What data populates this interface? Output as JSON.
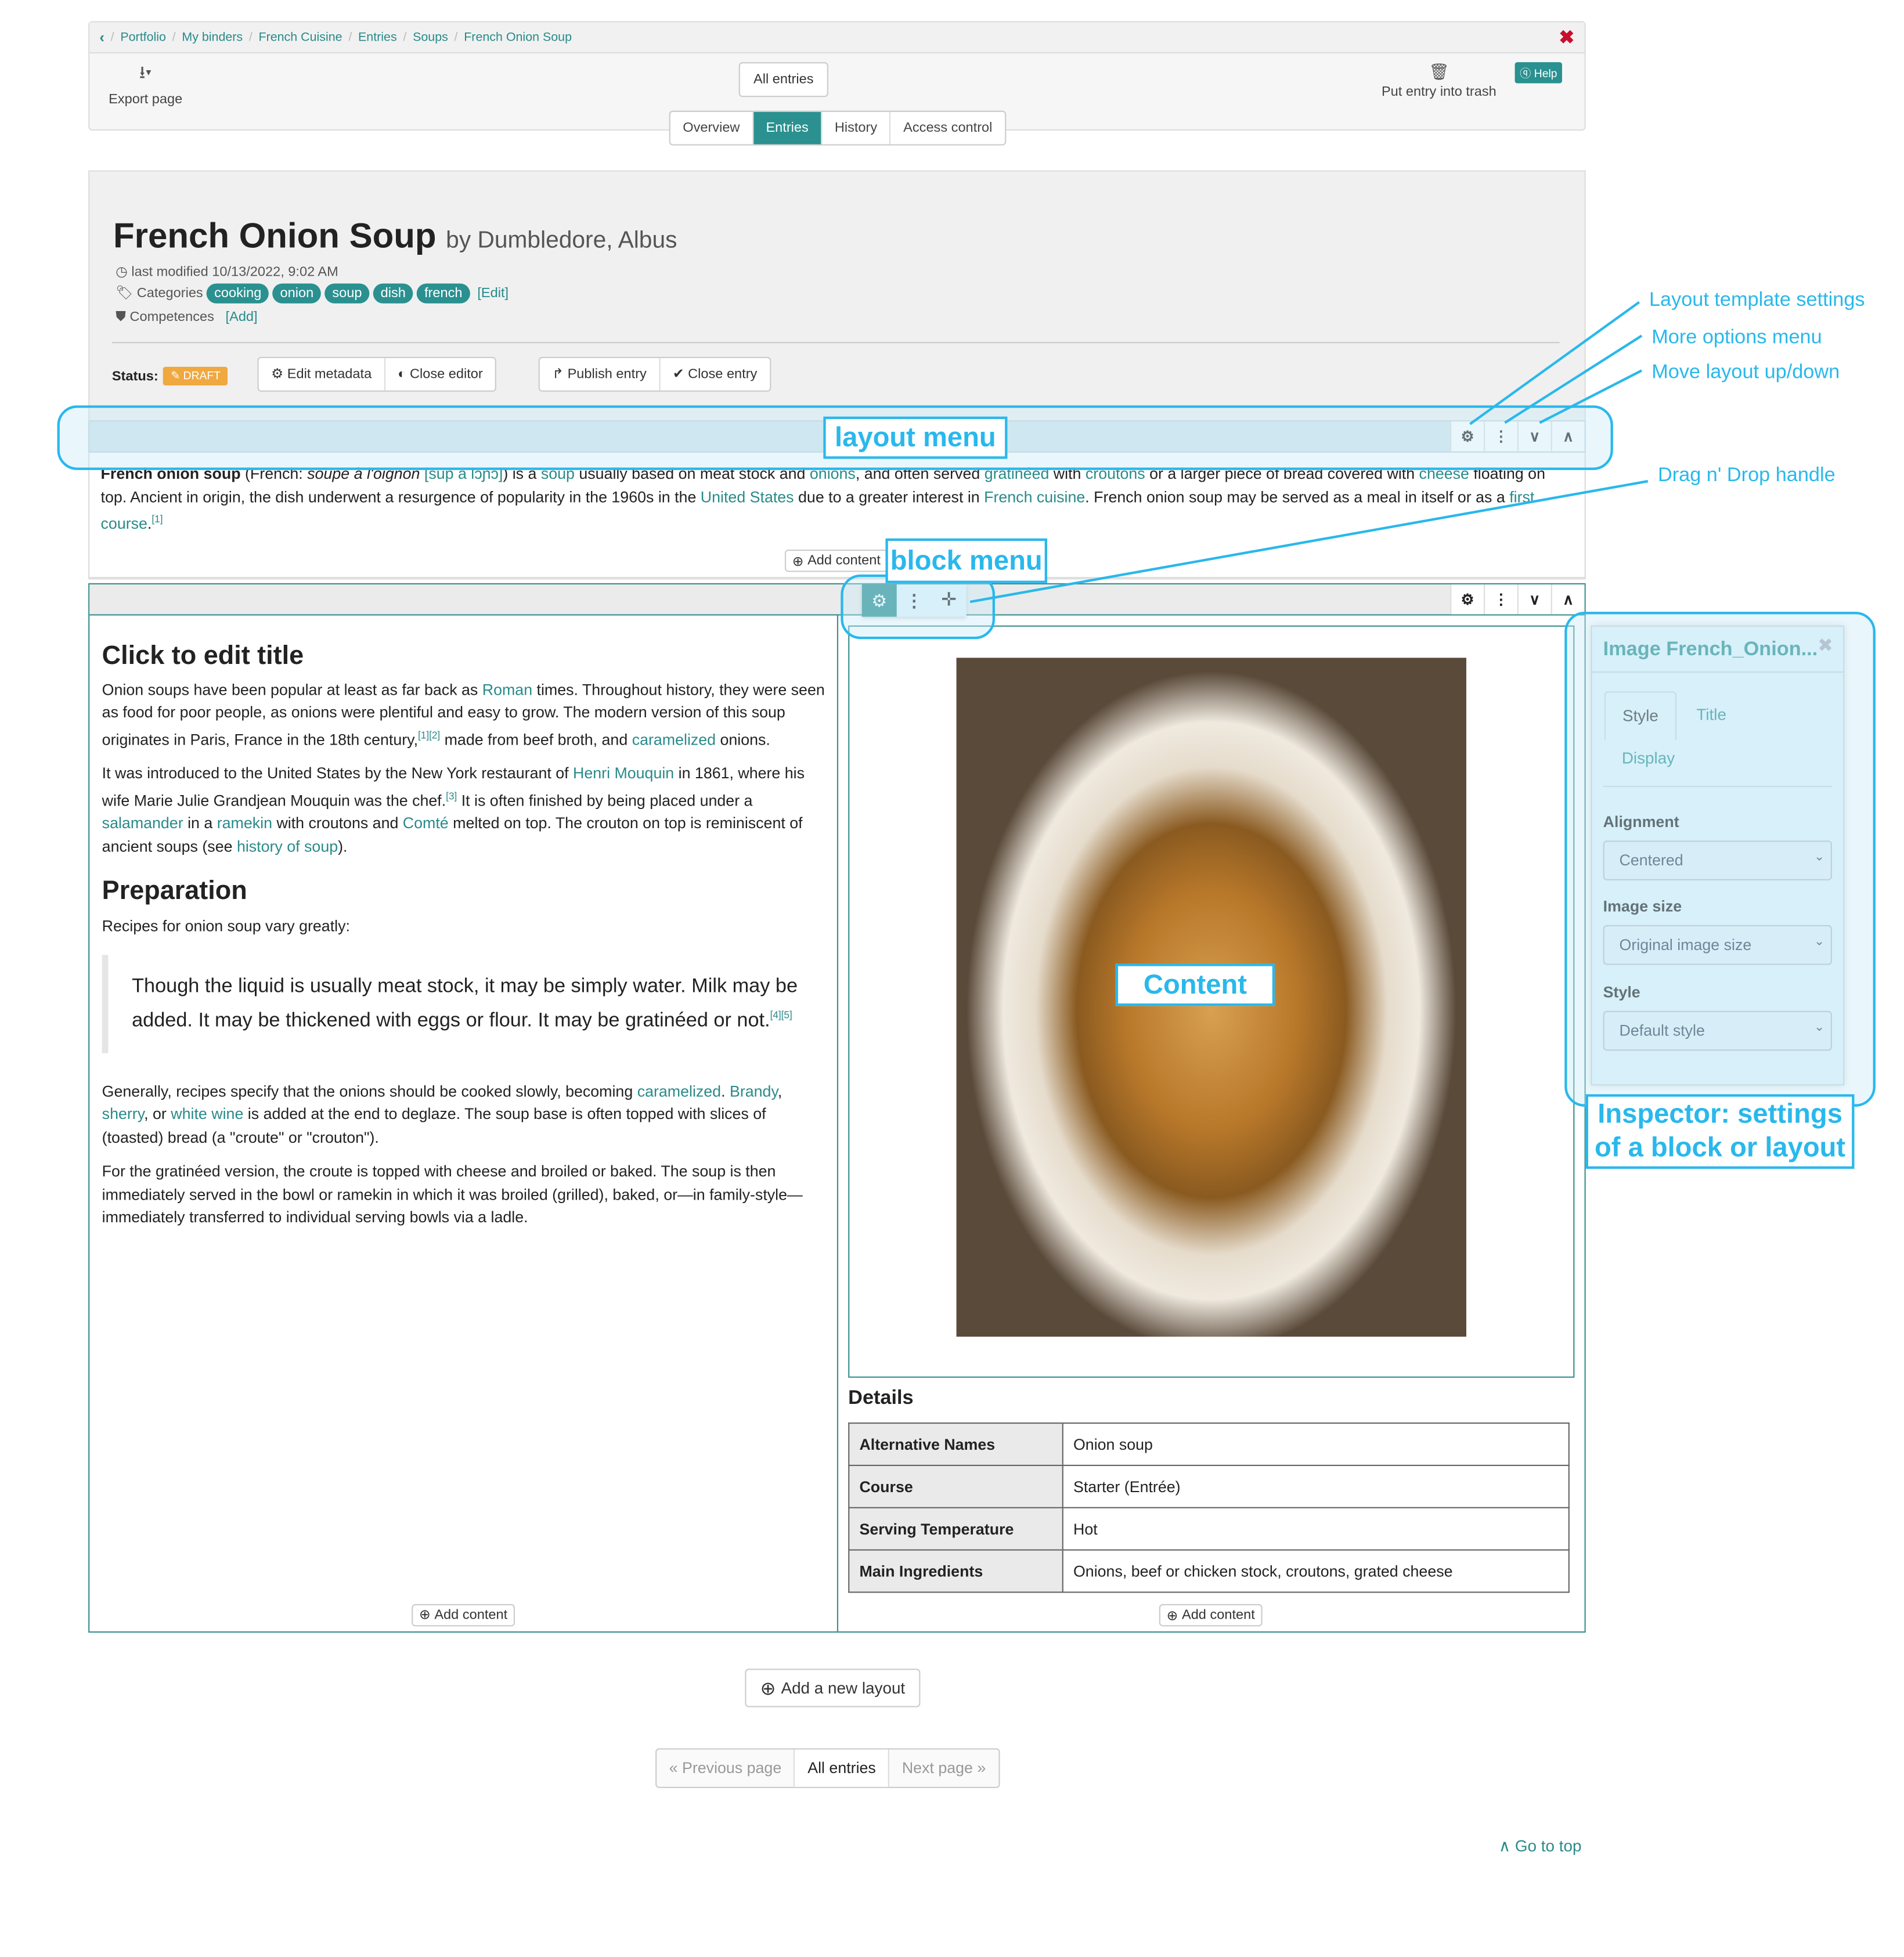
{
  "breadcrumb": {
    "back_icon": "chevron-left-icon",
    "items": [
      "Portfolio",
      "My binders",
      "French Cuisine",
      "Entries",
      "Soups",
      "French Onion Soup"
    ]
  },
  "toolbar": {
    "export_label": "Export page",
    "all_entries_label": "All entries",
    "trash_label": "Put entry into trash",
    "help_label": "Help",
    "close_icon": "close-icon"
  },
  "tabs": [
    {
      "label": "Overview",
      "active": false
    },
    {
      "label": "Entries",
      "active": true
    },
    {
      "label": "History",
      "active": false
    },
    {
      "label": "Access control",
      "active": false
    }
  ],
  "entry": {
    "title": "French Onion Soup",
    "author": "by Dumbledore, Albus",
    "last_modified": "last modified 10/13/2022, 9:02 AM",
    "categories_label": "Categories",
    "categories": [
      "cooking",
      "onion",
      "soup",
      "dish",
      "french"
    ],
    "categories_edit": "[Edit]",
    "competences_label": "Competences",
    "competences_add": "[Add]",
    "status_label": "Status:",
    "status_value": "DRAFT",
    "buttons": {
      "edit_metadata": "Edit metadata",
      "close_editor": "Close editor",
      "publish_entry": "Publish entry",
      "close_entry": "Close entry"
    }
  },
  "intro": {
    "bold": "French onion soup",
    "t1": " (French: ",
    "italic": "soupe à l'oignon",
    "ipa": "[sup a lɔɲɔ̃]",
    "t2": ") is a ",
    "l_soup": "soup",
    "t3": " usually based on meat stock and ",
    "l_onions": "onions",
    "t4": ", and often served ",
    "l_gratineed": "gratinéed",
    "t5": " with ",
    "l_croutons": "croutons",
    "t6": " or a larger piece of bread covered with ",
    "l_cheese": "cheese",
    "t7": " floating on top. Ancient in origin, the dish underwent a resurgence of popularity in the 1960s in the ",
    "l_us": "United States",
    "t8": " due to a greater interest in ",
    "l_cuisine": "French cuisine",
    "t9": ". French onion soup may be served as a meal in itself or as a ",
    "l_course": "first course",
    "t10": ".",
    "ref": "[1]"
  },
  "add_content_label": "Add content",
  "left_column": {
    "title": "Click to edit title",
    "p1": {
      "a": "Onion soups have been popular at least as far back as ",
      "l_roman": "Roman",
      "b": " times. Throughout history, they were seen as food for poor people, as onions were plentiful and easy to grow. The modern version of this soup originates in Paris, France in the 18th century,",
      "ref": "[1][2]",
      "c": " made from beef broth, and ",
      "l_caramelized": "caramelized",
      "d": " onions."
    },
    "p2": {
      "a": "It was introduced to the United States by the New York restaurant of ",
      "l_henri": "Henri Mouquin",
      "b": " in 1861, where his wife Marie Julie Grandjean Mouquin was the chef.",
      "ref": "[3]",
      "c": " It is often finished by being placed under a ",
      "l_salamander": "salamander",
      "d": " in a ",
      "l_ramekin": "ramekin",
      "e": " with croutons and ",
      "l_comte": "Comté",
      "f": " melted on top. The crouton on top is reminiscent of ancient soups (see ",
      "l_history": "history of soup",
      "g": ")."
    },
    "heading2": "Preparation",
    "p3": "Recipes for onion soup vary greatly:",
    "quote": "Though the liquid is usually meat stock, it may be simply water. Milk may be added. It may be thickened with eggs or flour. It may be gratinéed or not.",
    "quote_ref": "[4][5]",
    "p4": {
      "a": "Generally, recipes specify that the onions should be cooked slowly, becoming ",
      "l_caramelized": "caramelized",
      "b": ". ",
      "l_brandy": "Brandy",
      "c": ", ",
      "l_sherry": "sherry",
      "d": ", or ",
      "l_wine": "white wine",
      "e": " is added at the end to deglaze. The soup base is often topped with slices of (toasted) bread (a \"croute\" or \"crouton\")."
    },
    "p5": "For the gratinéed version, the croute is topped with cheese and broiled or baked. The soup is then immediately served in the bowl or ramekin in which it was broiled (grilled), baked, or—in family-style—immediately transferred to individual serving bowls via a ladle."
  },
  "right_column": {
    "image_alt": "French onion soup photo",
    "details_title": "Details",
    "details": [
      {
        "key": "Alternative Names",
        "value": "Onion soup"
      },
      {
        "key": "Course",
        "value": "Starter (Entrée)"
      },
      {
        "key": "Serving Temperature",
        "value": "Hot"
      },
      {
        "key": "Main Ingredients",
        "value": "Onions, beef or chicken stock, croutons, grated cheese"
      }
    ]
  },
  "inspector": {
    "title": "Image French_Onion...",
    "tabs": [
      "Style",
      "Title",
      "Display"
    ],
    "active_tab": "Style",
    "alignment_label": "Alignment",
    "alignment_value": "Centered",
    "image_size_label": "Image size",
    "image_size_value": "Original image size",
    "style_label": "Style",
    "style_value": "Default style"
  },
  "footer": {
    "add_layout": "Add a new layout",
    "prev_page": "« Previous page",
    "all_entries": "All entries",
    "next_page": "Next page »",
    "go_top": "Go to top"
  },
  "annotations": {
    "layout_template_settings": "Layout template settings",
    "more_options_menu": "More options menu",
    "move_layout": "Move layout up/down",
    "drag_drop": "Drag n' Drop handle",
    "layout_menu": "layout menu",
    "block_menu": "block menu",
    "content": "Content",
    "inspector_line1": "Inspector: settings",
    "inspector_line2": "of a block or layout"
  },
  "colors": {
    "brand_teal": "#2a9090",
    "annotation_blue": "#29b8ec",
    "draft_orange": "#f0a840",
    "close_red": "#c8102e"
  }
}
